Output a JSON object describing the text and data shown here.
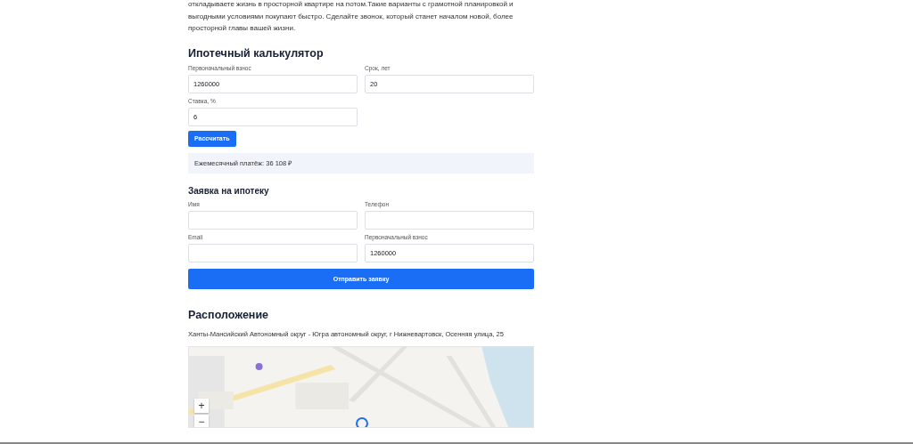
{
  "intro": "откладываете жизнь в просторной квартире на потом.Такие варианты с грамотной планировкой и выгодными условиями покупают быстро. Сделайте звонок, который станет началом новой, более просторной главы вашей жизни.",
  "calculator": {
    "title": "Ипотечный калькулятор",
    "fields": [
      {
        "label": "Первоначальный взнос",
        "value": "1260000"
      },
      {
        "label": "Срок, лет",
        "value": "20"
      },
      {
        "label": "Ставка, %",
        "value": "6"
      }
    ],
    "button": "Рассчитать",
    "result": "Ежемесячный платёж: 36 108 ₽"
  },
  "application": {
    "title": "Заявка на ипотеку",
    "fields": [
      {
        "label": "Имя"
      },
      {
        "label": "Телефон"
      },
      {
        "label": "Email"
      },
      {
        "label": "Первоначальный взнос",
        "value": "1260000"
      }
    ],
    "button": "Отправить заявку"
  },
  "location": {
    "title": "Расположение",
    "address": "Ханты-Мансийский Автономный округ - Югра автономный округ, г Нижневартовск, Осенняя улица, 25",
    "map": {
      "kind": "picture",
      "zoom_in": "+",
      "zoom_out": "−"
    }
  }
}
